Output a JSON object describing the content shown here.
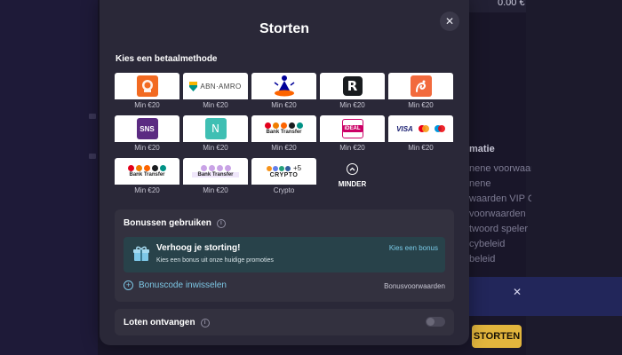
{
  "background": {
    "balance": "0.00 €",
    "info_header": "matie",
    "info_lines": [
      "nene voorwaar",
      "nene",
      "waarden VIP Cl",
      "voorwaarden",
      "twoord speler",
      "cybeleid",
      "beleid"
    ],
    "banner_close_icon": "close-icon",
    "deposit_button": "STORTEN"
  },
  "modal": {
    "title": "Storten",
    "close_icon": "close-icon",
    "section_label": "Kies een betaalmethode",
    "methods": [
      {
        "id": "ing",
        "min": "Min €20"
      },
      {
        "id": "abnamro",
        "logo_text": "ABN·AMRO",
        "min": "Min €20"
      },
      {
        "id": "rabobank",
        "min": "Min €20"
      },
      {
        "id": "revolut",
        "logo_text": "R",
        "min": "Min €20"
      },
      {
        "id": "knab",
        "min": "Min €20"
      },
      {
        "id": "sns",
        "logo_text": "SNS",
        "min": "Min €20"
      },
      {
        "id": "n26",
        "logo_text": "N",
        "min": "Min €20"
      },
      {
        "id": "bank-transfer-1",
        "logo_text": "Bank Transfer",
        "min": "Min €20"
      },
      {
        "id": "ideal",
        "logo_text": "iDEAL",
        "min": "Min €20"
      },
      {
        "id": "cards",
        "logo_text": "VISA",
        "min": "Min €20"
      },
      {
        "id": "bank-transfer-2",
        "logo_text": "Bank Transfer",
        "min": "Min €20"
      },
      {
        "id": "bank-transfer-3",
        "logo_text": "Bank Transfer",
        "min": "Min €20"
      },
      {
        "id": "crypto",
        "logo_text": "CRYPTO",
        "extra": "+5",
        "min": "Crypto"
      }
    ],
    "minder_label": "MINDER",
    "bonus": {
      "title": "Bonussen gebruiken",
      "promo_title": "Verhoog je storting!",
      "promo_subtitle": "Kies een bonus uit onze huidige promoties",
      "promo_link": "Kies een bonus",
      "code_link": "Bonuscode inwisselen",
      "terms_link": "Bonusvoorwaarden"
    },
    "loten": {
      "title": "Loten ontvangen",
      "toggle_on": false
    }
  },
  "colors": {
    "modal_bg": "#2a2838",
    "card_bg": "#33313f",
    "promo_bg": "#28424a",
    "accent_link": "#7cc6e4",
    "deposit_gold": "#e2b53d"
  }
}
